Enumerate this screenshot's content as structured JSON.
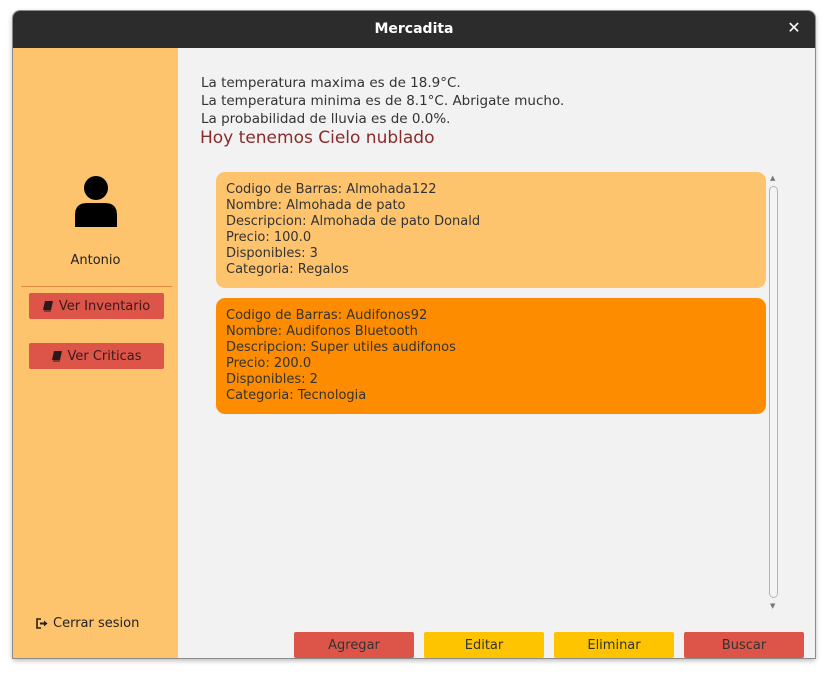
{
  "window": {
    "title": "Mercadita"
  },
  "sidebar": {
    "username": "Antonio",
    "buttons": [
      {
        "label": "Ver Inventario",
        "icon": "book-icon"
      },
      {
        "label": "Ver Criticas",
        "icon": "book-icon"
      }
    ],
    "logout_label": "Cerrar sesion"
  },
  "weather": {
    "lines": [
      "La temperatura maxima es de 18.9°C.",
      "La temperatura minima es de 8.1°C. Abrigate mucho.",
      "La probabilidad de lluvia es de 0.0%."
    ],
    "headline": "Hoy tenemos Cielo nublado"
  },
  "products": [
    {
      "lines": [
        "Codigo de Barras: Almohada122",
        "Nombre: Almohada de pato",
        "Descripcion: Almohada de pato Donald",
        "Precio: 100.0",
        "Disponibles: 3",
        "Categoria: Regalos"
      ],
      "color": "#fec46d"
    },
    {
      "lines": [
        "Codigo de Barras: Audifonos92",
        "Nombre: Audifonos Bluetooth",
        "Descripcion: Super utiles audifonos",
        "Precio: 200.0",
        "Disponibles: 2",
        "Categoria: Tecnologia"
      ],
      "color": "#fd8c00"
    }
  ],
  "actions": [
    {
      "label": "Agregar",
      "color": "#dd5448"
    },
    {
      "label": "Editar",
      "color": "#fec400"
    },
    {
      "label": "Eliminar",
      "color": "#fec400"
    },
    {
      "label": "Buscar",
      "color": "#dd5448"
    }
  ],
  "colors": {
    "titlebar": "#2c2c2c",
    "sidebar": "#fec46d",
    "headline": "#8b2a2a"
  }
}
